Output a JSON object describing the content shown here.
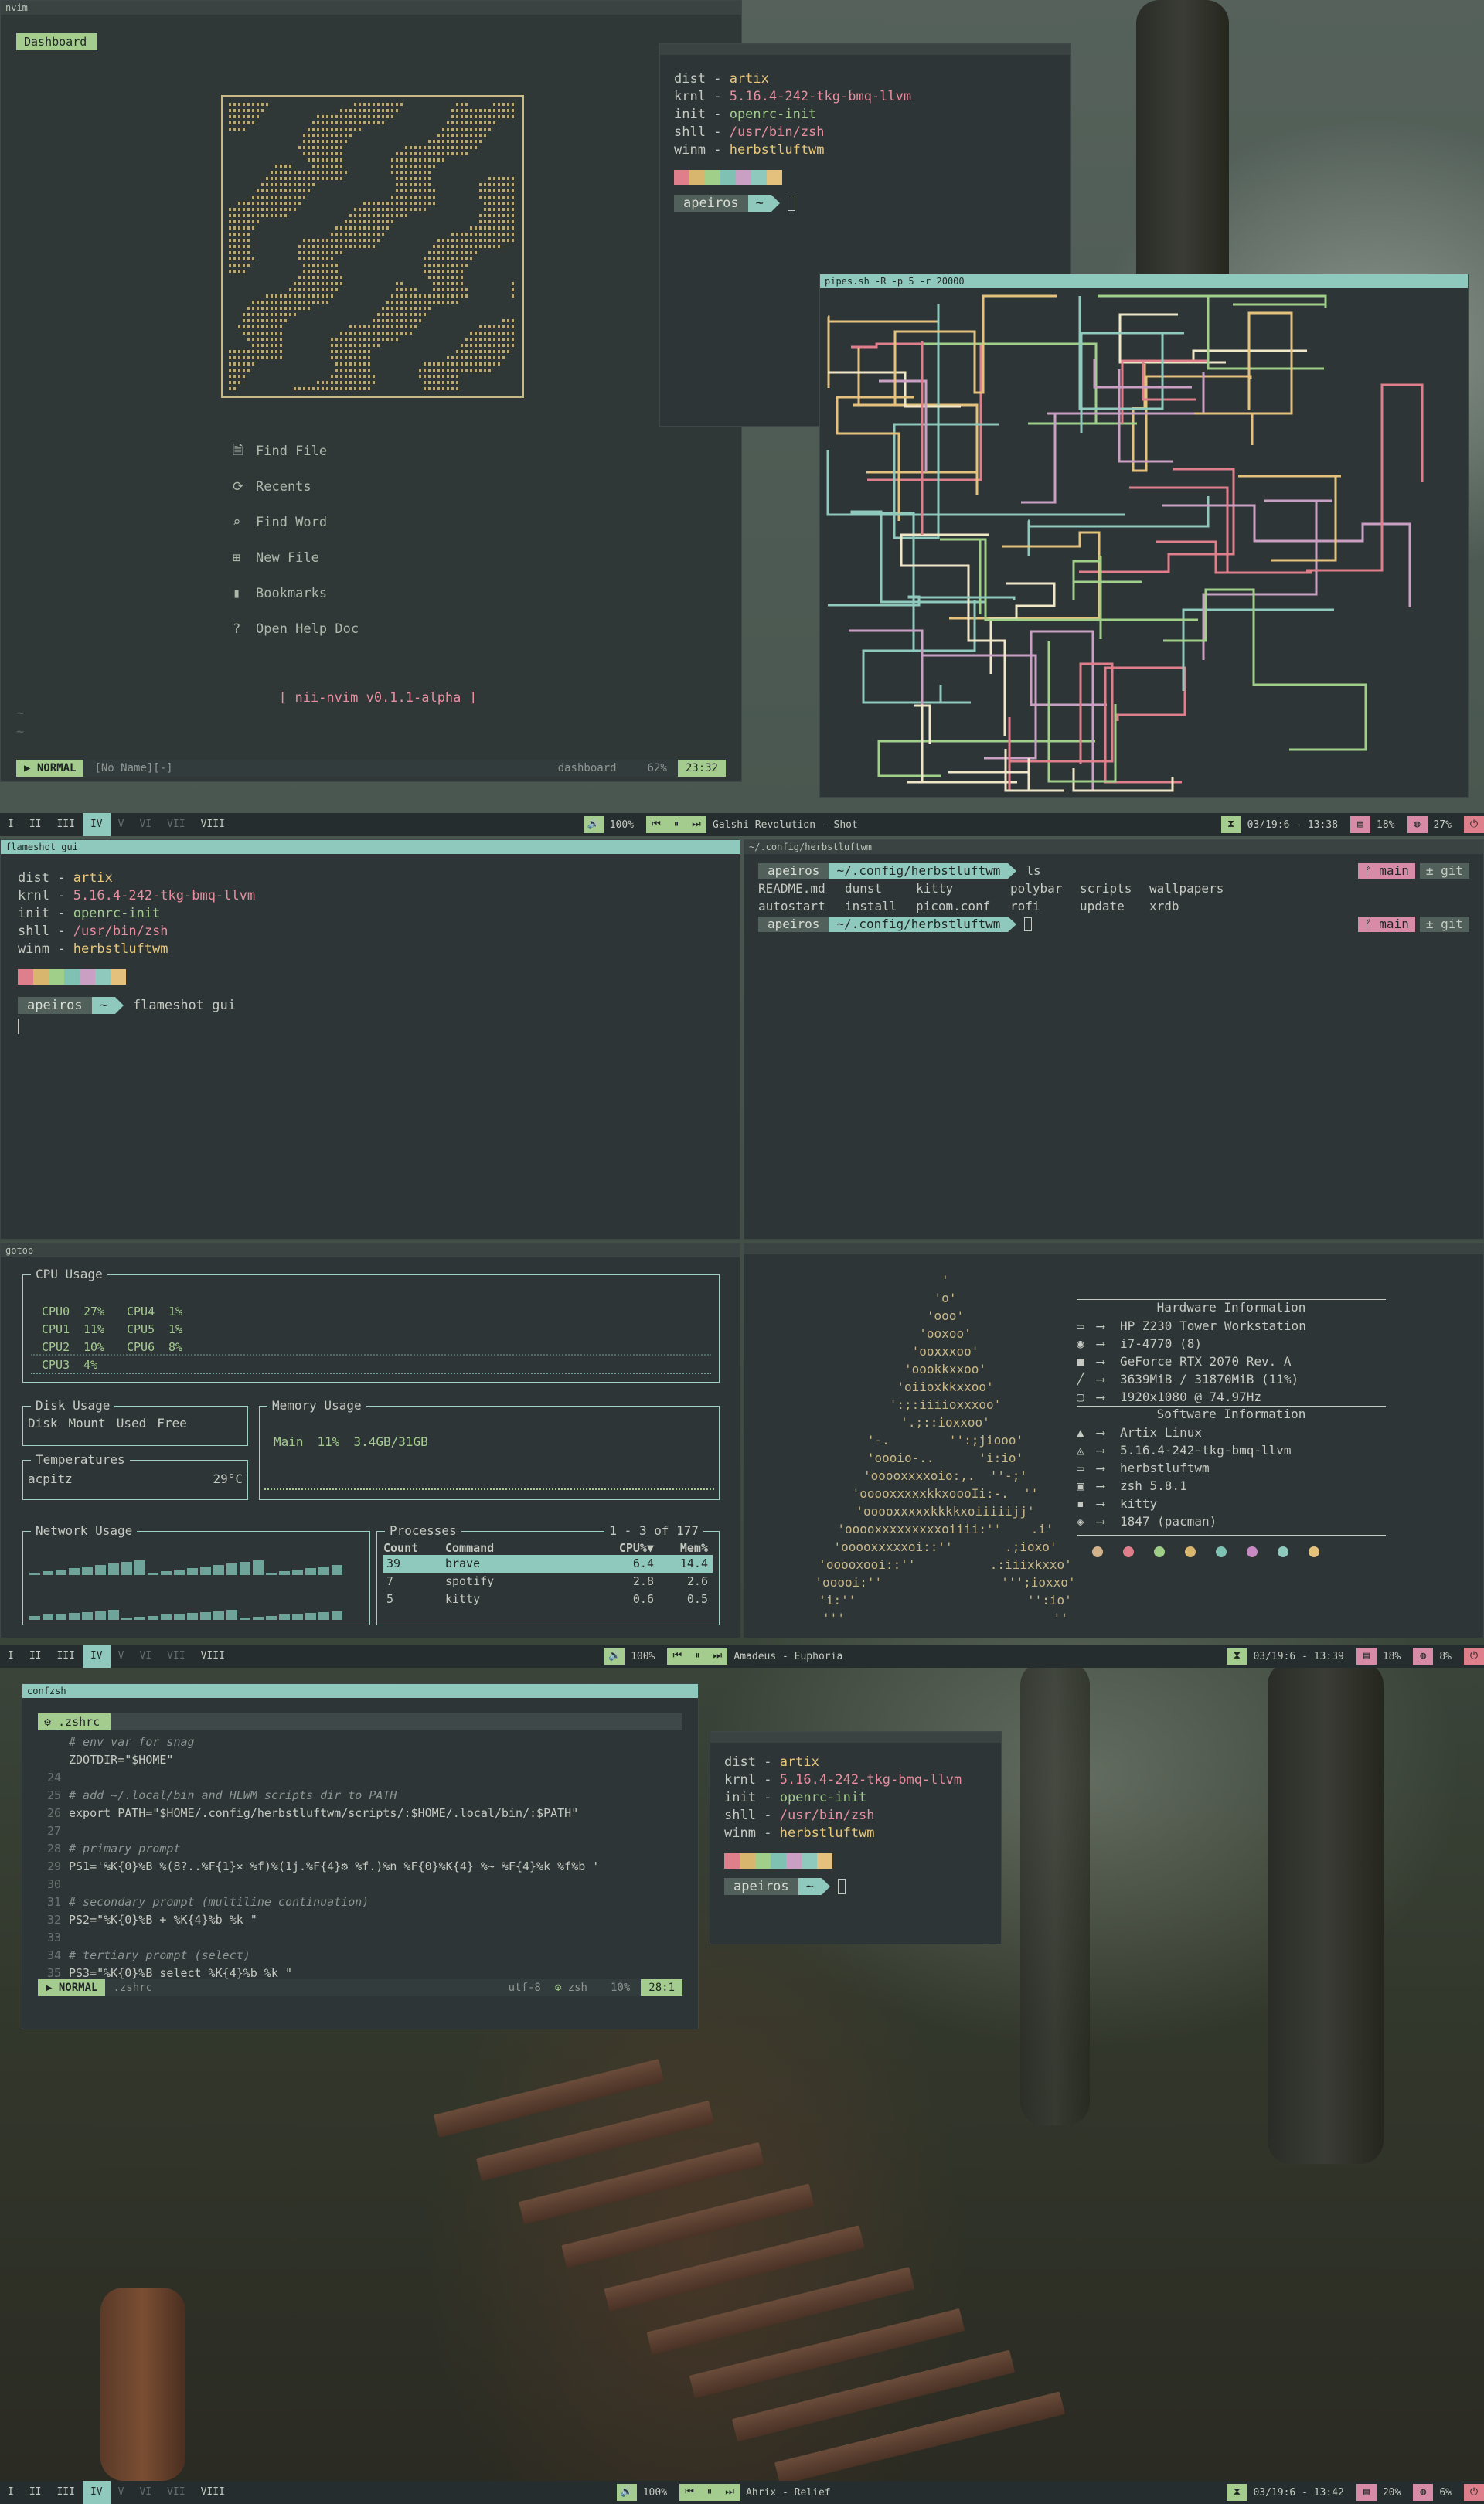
{
  "colors": {
    "accent": "#8fc8bc",
    "green": "#a4cc8f",
    "yellow": "#e8c77b",
    "pink": "#e78fa0",
    "bg": "#2e3536"
  },
  "fetch": {
    "keys": [
      "dist",
      "krnl",
      "init",
      "shll",
      "winm"
    ],
    "vals": [
      "artix",
      "5.16.4-242-tkg-bmq-llvm",
      "openrc-init",
      "/usr/bin/zsh",
      "herbstluftwm"
    ],
    "seps": [
      "-",
      "-",
      "-",
      "-",
      "-"
    ]
  },
  "prompt": {
    "user": "apeiros",
    "dir": "~"
  },
  "swatch_colors": [
    "#e07f8c",
    "#d9b66e",
    "#9fcf88",
    "#7fc1b3",
    "#c9a0c4",
    "#8fc8bc",
    "#e4c27d"
  ],
  "nvim": {
    "title": "nvim",
    "dashboard_tab": "Dashboard",
    "menu": [
      {
        "icon": "file-icon",
        "label": "Find File"
      },
      {
        "icon": "refresh-icon",
        "label": "Recents"
      },
      {
        "icon": "search-icon",
        "label": "Find Word"
      },
      {
        "icon": "plus-icon",
        "label": "New File"
      },
      {
        "icon": "bookmark-icon",
        "label": "Bookmarks"
      },
      {
        "icon": "help-icon",
        "label": "Open Help Doc"
      }
    ],
    "version": "[ nii-nvim v0.1.1-alpha ]",
    "tildes": [
      "~",
      "~"
    ],
    "status_mode": "NORMAL",
    "status_file": "[No Name][-]",
    "status_ft": "dashboard",
    "status_pct": "62%",
    "status_pos": "23:32"
  },
  "pipes": {
    "title": "pipes.sh -R -p 5 -r 20000"
  },
  "bars": [
    {
      "tags": [
        "I",
        "II",
        "III",
        "IV",
        "V",
        "VI",
        "VII",
        "VIII"
      ],
      "volume": "100%",
      "song": "Galshi Revolution - Shot",
      "date": "03/19:6 - 13:38",
      "mem": "18%",
      "cpu": "27%"
    },
    {
      "tags": [
        "I",
        "II",
        "III",
        "IV",
        "V",
        "VI",
        "VII",
        "VIII"
      ],
      "volume": "100%",
      "song": "Amadeus - Euphoria",
      "date": "03/19:6 - 13:39",
      "mem": "18%",
      "cpu": "8%"
    },
    {
      "tags": [
        "I",
        "II",
        "III",
        "IV",
        "V",
        "VI",
        "VII",
        "VIII"
      ],
      "volume": "100%",
      "song": "Ahrix - Relief",
      "date": "03/19:6 - 13:42",
      "mem": "20%",
      "cpu": "6%"
    }
  ],
  "flameshot": {
    "title": "flameshot gui",
    "command": "flameshot gui"
  },
  "herbst": {
    "title": "~/.config/herbstluftwm",
    "dir": "~/.config/herbstluftwm",
    "cmd": "ls",
    "branch": "main",
    "git": "± git",
    "ls": [
      [
        "README.md",
        "dunst",
        "kitty",
        "polybar",
        "scripts",
        "wallpapers"
      ],
      [
        "autostart",
        "install",
        "picom.conf",
        "rofi",
        "update",
        "xrdb"
      ]
    ]
  },
  "gotop": {
    "title": "gotop",
    "cpu_label": "CPU Usage",
    "cpus": [
      [
        "CPU0",
        "27%",
        "CPU4",
        "1%"
      ],
      [
        "CPU1",
        "11%",
        "CPU5",
        "1%"
      ],
      [
        "CPU2",
        "10%",
        "CPU6",
        "8%"
      ],
      [
        "CPU3",
        "4%",
        "",
        ""
      ]
    ],
    "disk_label": "Disk Usage",
    "disk_cols": [
      "Disk",
      "Mount",
      "Used",
      "Free"
    ],
    "temp_label": "Temperatures",
    "temp_name": "acpitz",
    "temp_val": "29°C",
    "mem_label": "Memory Usage",
    "mem_row": [
      "Main",
      "11%",
      "3.4GB/31GB"
    ],
    "net_label": "Network Usage",
    "proc_label": "Processes",
    "proc_count": "1 - 3 of 177",
    "proc_cols": [
      "Count",
      "Command",
      "CPU%▼",
      "Mem%"
    ],
    "procs": [
      [
        "39",
        "brave",
        "6.4",
        "14.4"
      ],
      [
        "7",
        "spotify",
        "2.8",
        "2.6"
      ],
      [
        "5",
        "kitty",
        "0.6",
        "0.5"
      ]
    ]
  },
  "hwinfo": {
    "hw_title": "Hardware Information",
    "hw": [
      {
        "icon": "computer-icon",
        "val": "HP Z230 Tower Workstation"
      },
      {
        "icon": "cpu-icon",
        "val": "i7-4770 (8)"
      },
      {
        "icon": "gpu-icon",
        "val": "GeForce RTX 2070 Rev. A"
      },
      {
        "icon": "memory-icon",
        "val": "3639MiB / 31870MiB (11%)"
      },
      {
        "icon": "monitor-icon",
        "val": "1920x1080 @ 74.97Hz"
      }
    ],
    "sw_title": "Software Information",
    "sw": [
      {
        "icon": "arch-icon",
        "val": "Artix Linux"
      },
      {
        "icon": "kernel-icon",
        "val": "5.16.4-242-tkg-bmq-llvm"
      },
      {
        "icon": "window-icon",
        "val": "herbstluftwm"
      },
      {
        "icon": "shell-icon",
        "val": "zsh 5.8.1"
      },
      {
        "icon": "terminal-icon",
        "val": "kitty"
      },
      {
        "icon": "package-icon",
        "val": "1847 (pacman)"
      }
    ],
    "ascii": [
      "'",
      "'o'",
      "'ooo'",
      "'ooxoo'",
      "'ooxxxoo'",
      "'oookkxxoo'",
      "'oiioxkkxxoo'",
      "':;:iiiioxxxoo'",
      "'.;::ioxxoo'",
      "'-.        '':;jiooo'",
      "'oooio-..      'i:io'",
      "'ooooxxxxoio:,.  ''-;'",
      "'ooooxxxxxkkxoooIi:-.  ''",
      "'ooooxxxxxkkkkxoiiiiijj'",
      "'ooooxxxxxxxxxoiiii:''    .i'",
      "'ooooxxxxxoi::''       .;ioxo'",
      "'ooooxooi::''          .:iiixkxxo'",
      "'ooooi:''                ''';ioxxo'",
      "'i:''                       '':io'",
      "'''                            ''"
    ],
    "dots": [
      "#d2b48c",
      "#e07f8c",
      "#9fcf88",
      "#d9b66e",
      "#7fc1b3",
      "#c78ac2",
      "#8fc8bc",
      "#e4c27d"
    ]
  },
  "confzsh": {
    "title": "confzsh",
    "tab": ".zshrc",
    "lines": [
      {
        "n": "",
        "t": "# env var for snag",
        "c": "cm"
      },
      {
        "n": "",
        "t": "ZDOTDIR=\"$HOME\"",
        "c": ""
      },
      {
        "n": "24",
        "t": "",
        "c": ""
      },
      {
        "n": "25",
        "t": "# add ~/.local/bin and HLWM scripts dir to PATH",
        "c": "cm"
      },
      {
        "n": "26",
        "t": "export PATH=\"$HOME/.config/herbstluftwm/scripts/:$HOME/.local/bin/:$PATH\"",
        "c": ""
      },
      {
        "n": "27",
        "t": "",
        "c": ""
      },
      {
        "n": "28",
        "t": "# primary prompt",
        "c": "cm"
      },
      {
        "n": "29",
        "t": "PS1='%K{0}%B %(8?..%F{1}✕ %f)%(1j.%F{4}⚙ %f.)%n %F{0}%K{4} %~ %F{4}%k %f%b '",
        "c": ""
      },
      {
        "n": "30",
        "t": "",
        "c": ""
      },
      {
        "n": "31",
        "t": "# secondary prompt (multiline continuation)",
        "c": "cm"
      },
      {
        "n": "32",
        "t": "PS2=\"%K{0}%B + %K{4}%b %k \"",
        "c": ""
      },
      {
        "n": "33",
        "t": "",
        "c": ""
      },
      {
        "n": "34",
        "t": "# tertiary prompt (select)",
        "c": "cm"
      },
      {
        "n": "35",
        "t": "PS3=\"%K{0}%B select %K{4}%b %k \"",
        "c": ""
      }
    ],
    "status_mode": "NORMAL",
    "status_file": ".zshrc",
    "status_enc": "utf-8",
    "status_ft": "zsh",
    "status_pct": "10%",
    "status_pos": "28:1"
  }
}
